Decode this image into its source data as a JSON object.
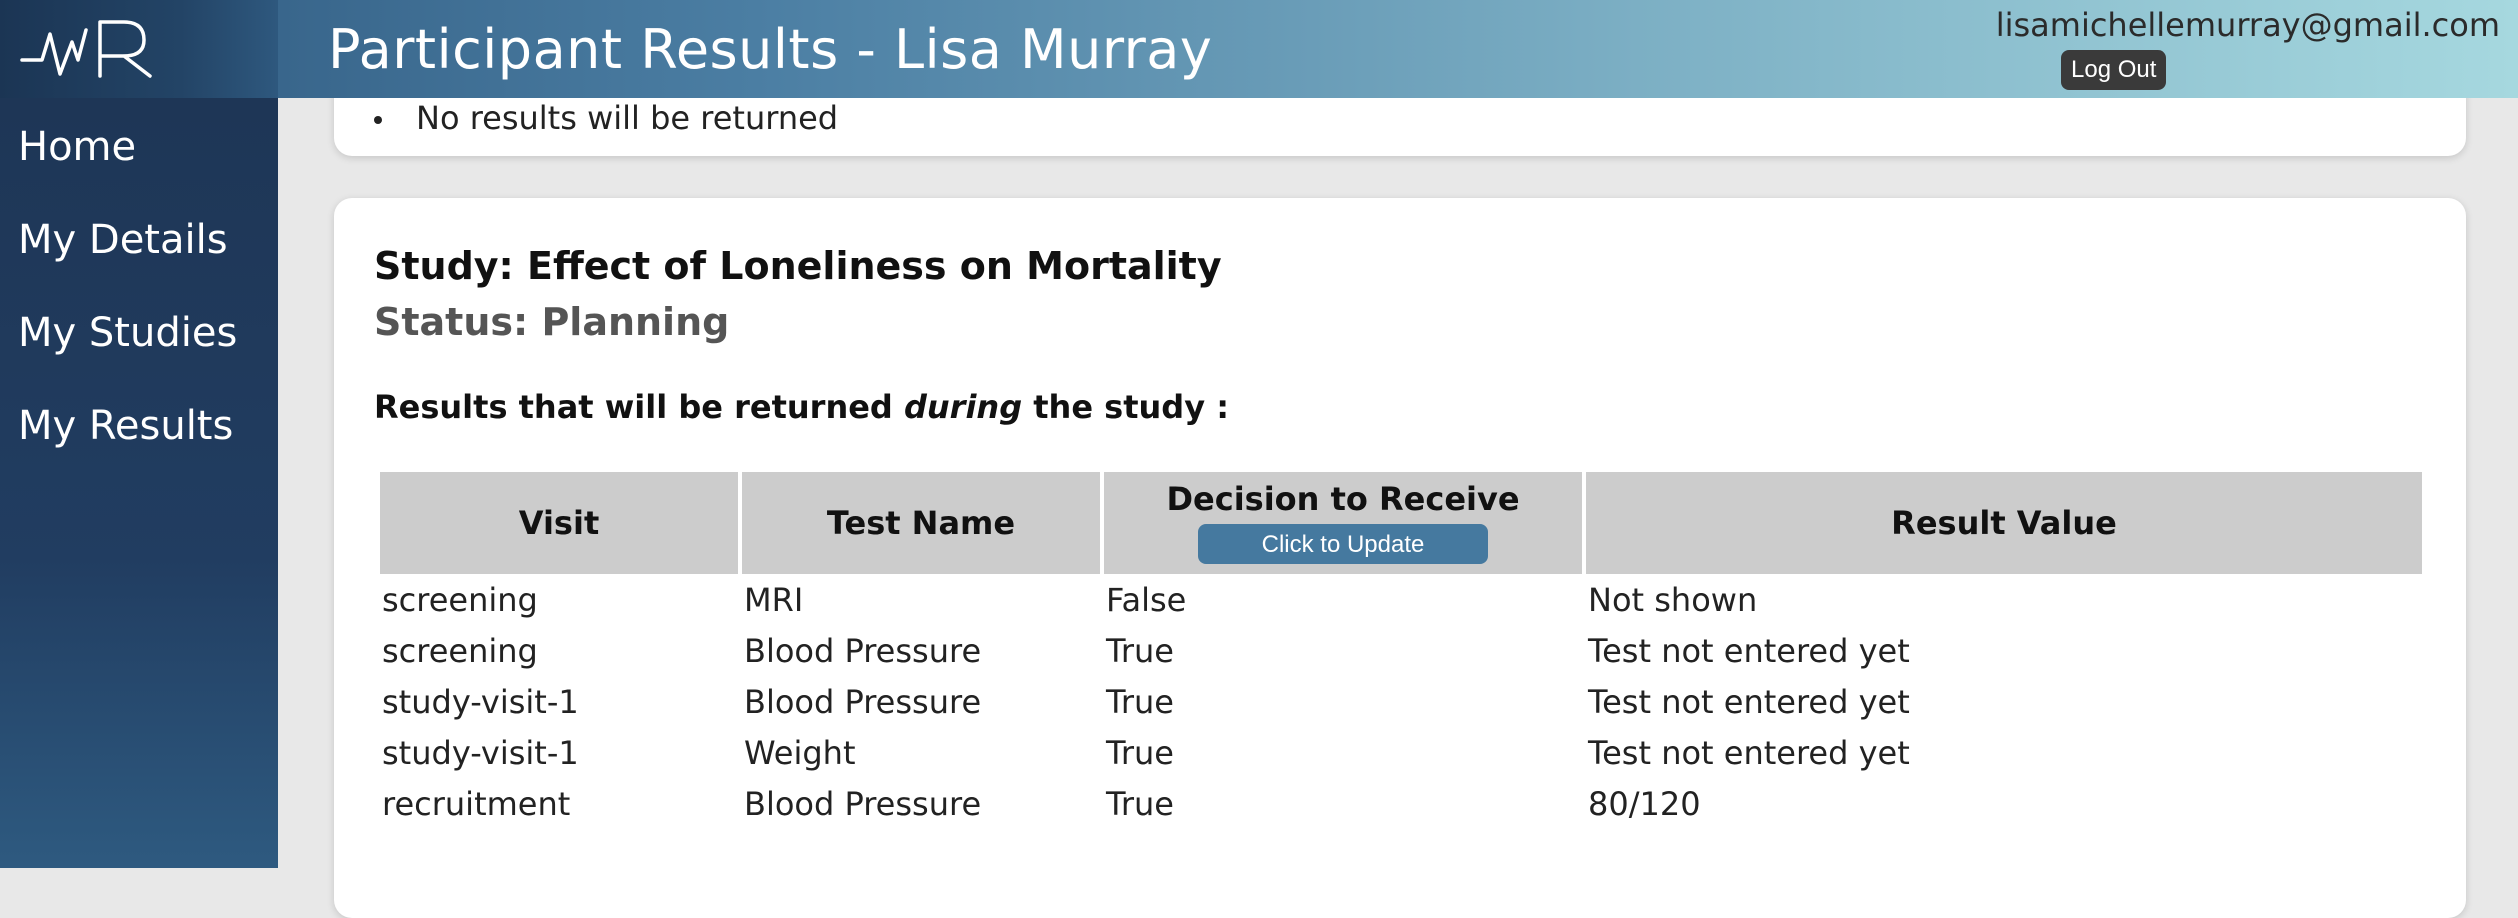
{
  "header": {
    "logo": "MR",
    "title": "Participant Results - Lisa Murray",
    "user_email": "lisamichellemurray@gmail.com",
    "logout_label": "Log Out"
  },
  "sidebar": {
    "items": [
      {
        "label": "Home"
      },
      {
        "label": "My Details"
      },
      {
        "label": "My Studies"
      },
      {
        "label": "My Results"
      }
    ]
  },
  "top_card": {
    "bullet_text": "No results will be returned"
  },
  "study": {
    "title": "Study: Effect of Loneliness on Mortality",
    "status": "Status: Planning",
    "results_heading_before": "Results that will be returned ",
    "results_heading_emph": "during",
    "results_heading_after": " the study :"
  },
  "table": {
    "headers": {
      "visit": "Visit",
      "test_name": "Test Name",
      "decision": "Decision to Receive",
      "update_button": "Click to Update",
      "result_value": "Result Value"
    },
    "rows": [
      {
        "visit": "screening",
        "test": "MRI",
        "decision": "False",
        "result": "Not shown"
      },
      {
        "visit": "screening",
        "test": "Blood Pressure",
        "decision": "True",
        "result": "Test not entered yet"
      },
      {
        "visit": "study-visit-1",
        "test": "Blood Pressure",
        "decision": "True",
        "result": "Test not entered yet"
      },
      {
        "visit": "study-visit-1",
        "test": "Weight",
        "decision": "True",
        "result": "Test not entered yet"
      },
      {
        "visit": "recruitment",
        "test": "Blood Pressure",
        "decision": "True",
        "result": "80/120"
      }
    ]
  }
}
